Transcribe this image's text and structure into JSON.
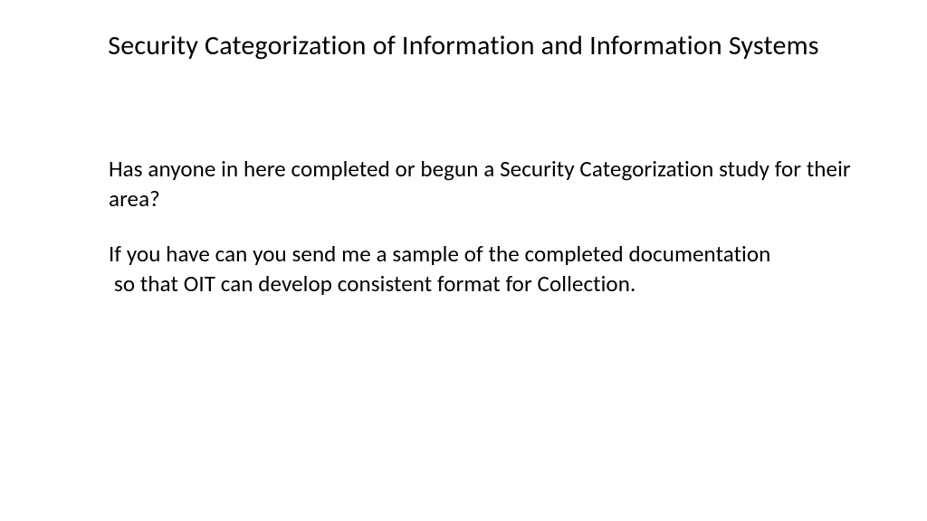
{
  "slide": {
    "title": "Security Categorization of Information and Information Systems",
    "body": {
      "p1": "Has anyone in here completed or begun a Security Categorization study for their area?",
      "p2_line1": "If you have can you send me a sample of the completed documentation",
      "p2_line2": " so that OIT can develop consistent format for Collection."
    }
  }
}
